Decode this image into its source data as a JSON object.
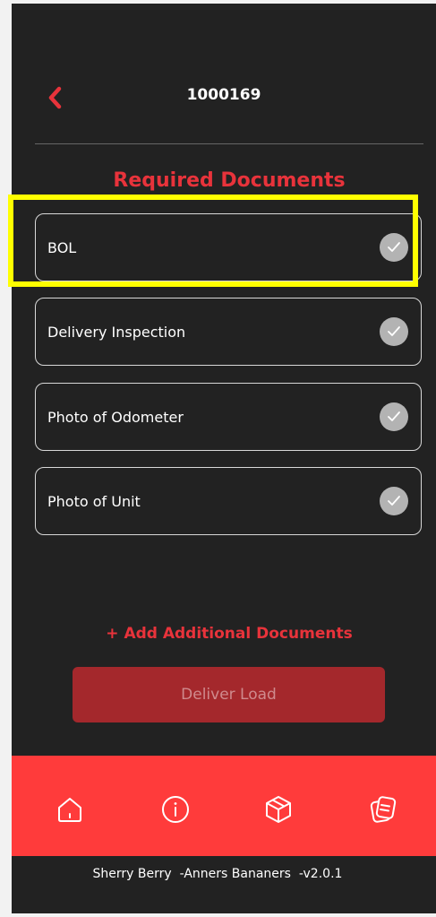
{
  "header": {
    "title": "1000169",
    "back_icon": "chevron-left-icon"
  },
  "section_title": "Required Documents",
  "documents": [
    {
      "label": "BOL",
      "status_icon": "checkmark-icon"
    },
    {
      "label": "Delivery Inspection",
      "status_icon": "checkmark-icon"
    },
    {
      "label": "Photo of Odometer",
      "status_icon": "checkmark-icon"
    },
    {
      "label": "Photo of Unit",
      "status_icon": "checkmark-icon"
    }
  ],
  "add_documents_label": "+ Add Additional Documents",
  "deliver_button_label": "Deliver Load",
  "bottom_nav": {
    "items": [
      "home-icon",
      "info-icon",
      "package-icon",
      "documents-icon"
    ]
  },
  "footer_text": "Sherry Berry  -Anners Bananers  -v2.0.1",
  "colors": {
    "background": "#222222",
    "accent": "#e8333b",
    "nav_background": "#ff3b3b",
    "disabled_button": "#a4282c",
    "highlight": "#ffff00"
  }
}
